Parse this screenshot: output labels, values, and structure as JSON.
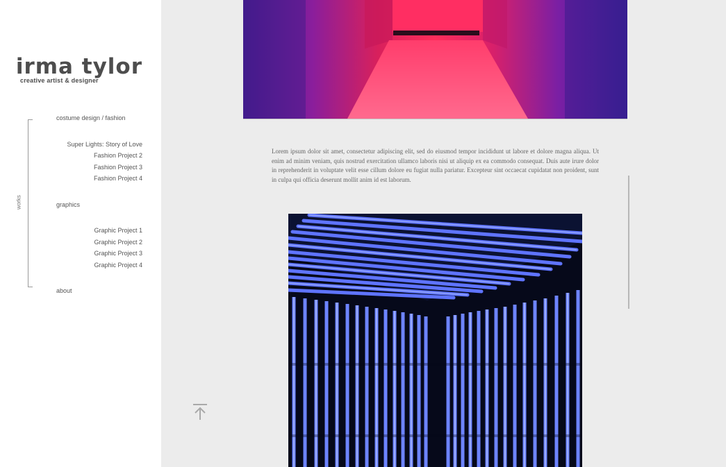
{
  "site": {
    "name": "irma tylor",
    "tagline": "creative artist & designer"
  },
  "sidebar": {
    "works_label": "works",
    "sections": [
      {
        "label": "costume design / fashion",
        "items": [
          "Super Lights: Story of Love",
          "Fashion Project 2",
          "Fashion Project 3",
          "Fashion Project 4"
        ]
      },
      {
        "label": "graphics",
        "items": [
          "Graphic Project 1",
          "Graphic Project 2",
          "Graphic Project 3",
          "Graphic Project 4"
        ]
      }
    ],
    "about_label": "about"
  },
  "main": {
    "paragraph": "Lorem ipsum dolor sit amet, consectetur adipiscing elit, sed do eiusmod tempor incididunt ut labore et dolore magna aliqua. Ut enim ad minim veniam, quis nostrud exercitation ullamco laboris nisi ut aliquip ex ea commodo consequat. Duis aute irure dolor in reprehenderit in voluptate velit esse cillum dolore eu fugiat nulla pariatur. Excepteur sint occaecat cupidatat non proident, sunt in culpa qui officia deserunt mollit anim id est laborum."
  },
  "icons": {
    "back_to_top": "arrow-up-to-line-icon"
  },
  "colors": {
    "sidebar_bg": "#ffffff",
    "page_bg": "#ececec",
    "text": "#4d4d4d"
  }
}
